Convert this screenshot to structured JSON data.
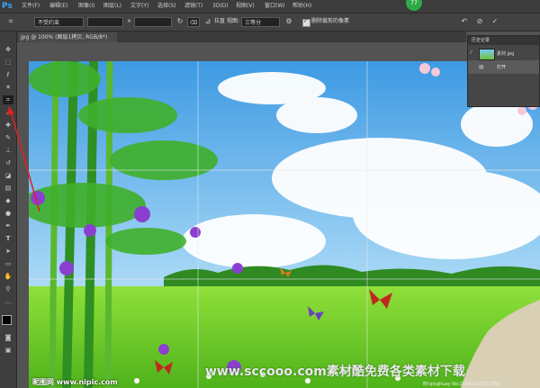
{
  "app": {
    "logo": "Ps",
    "badge": "77"
  },
  "menu": [
    "文件(F)",
    "编辑(E)",
    "图像(I)",
    "图层(L)",
    "文字(Y)",
    "选择(S)",
    "滤镜(T)",
    "3D(D)",
    "视图(V)",
    "窗口(W)",
    "帮助(H)"
  ],
  "options": {
    "ratio_value": "不受约束",
    "swap_symbol": "×",
    "straighten_label": "拉直",
    "view_label": "视图:",
    "view_value": "三等分",
    "delete_cropped_label": "删除裁剪的像素",
    "delete_cropped_checked": true
  },
  "document": {
    "tab_label": "jpg @ 100% (图层1拷贝, RGB/8*)"
  },
  "history": {
    "title": "历史记录",
    "items": [
      {
        "label": "素材.jpg",
        "selected": false
      },
      {
        "label": "打开",
        "selected": true
      }
    ]
  },
  "watermarks": {
    "main": "www.sccooo.com素材酷免费各类素材下载",
    "logo": "昵图网 www.nipic.com",
    "id": "BY:qinghuay No:20161222337265"
  },
  "colors": {
    "accent": "#31a8ff",
    "sky": "#6db6ea",
    "grass": "#7ed321",
    "bamboo": "#3fa32a"
  }
}
